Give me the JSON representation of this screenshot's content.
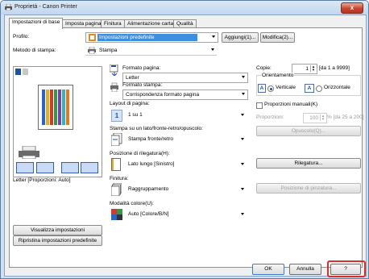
{
  "window": {
    "title": "Proprietà - Canon Printer",
    "close_label": "x"
  },
  "tabs": [
    "Impostazioni di base",
    "Imposta pagina",
    "Finitura",
    "Alimentazione carta",
    "Qualità"
  ],
  "profile": {
    "label": "Profilo:",
    "value": "Impostazioni predefinite",
    "add_button": "Aggiungi(1)...",
    "edit_button": "Modifica(2)..."
  },
  "output_method": {
    "label": "Metodo di stampa:",
    "value": "Stampa"
  },
  "preview": {
    "caption": "Letter [Proporzioni: Auto]"
  },
  "left_buttons": {
    "view_settings": "Visualizza impostazioni",
    "restore_defaults": "Ripristina impostazioni predefinite"
  },
  "page_size": {
    "label": "Formato pagina:",
    "value": "Letter"
  },
  "output_size": {
    "label": "Formato stampa:",
    "value": "Corrispondenza formato pagina"
  },
  "copies": {
    "label": "Copie:",
    "value": "1",
    "range": "[da 1 a 9999]"
  },
  "orientation": {
    "label": "Orientamento",
    "portrait": "Verticale",
    "landscape": "Orizzontale",
    "portrait_glyph": "A",
    "landscape_glyph": "A"
  },
  "page_layout": {
    "label": "Layout di pagina:",
    "value": "1 su 1",
    "glyph": "1"
  },
  "manual_scaling": {
    "label": "Proporzioni manuali(K)",
    "scaling_label": "Proporzioni:",
    "scaling_value": "100",
    "scaling_range": "% [da 25 a 200]"
  },
  "duplex": {
    "label": "Stampa su un lato/fronte-retro/opuscolo:",
    "value": "Stampa fronte/retro",
    "booklet_button": "Opuscolo(Q)..."
  },
  "binding": {
    "label": "Posizione di rilegatura(H):",
    "value": "Lato lungo [Sinistro]",
    "binding_button": "Rilegatura..."
  },
  "finishing": {
    "label": "Finitura:",
    "value": "Raggruppamento",
    "staple_button": "Posizione di pinzatura..."
  },
  "color_mode": {
    "label": "Modalità colore(U):",
    "value": "Auto [Colore/B/N]"
  },
  "footer": {
    "ok": "OK",
    "cancel": "Annulla",
    "help": "?"
  },
  "colors": {
    "accent": "#3d8ee0",
    "highlight_border": "#d9302a",
    "title_bar": "#cfe0f2"
  }
}
